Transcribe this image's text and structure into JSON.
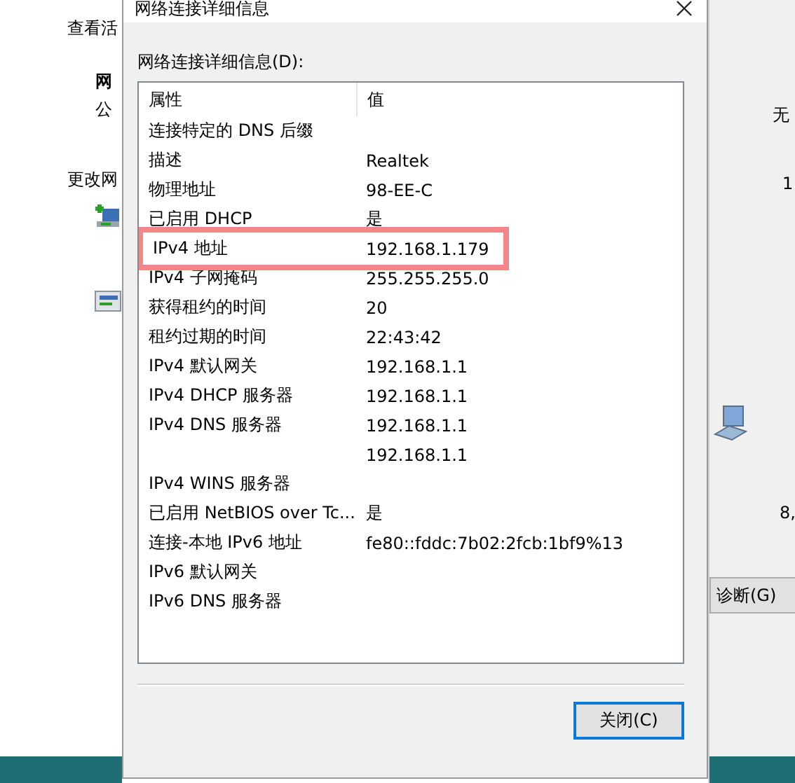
{
  "background_left": {
    "heading": "查看活",
    "network_name": "网",
    "network_type": "公",
    "change_heading": "更改网"
  },
  "background_right": {
    "text_1": "无",
    "text_2": "1",
    "text_3": "8,",
    "diagnose_button": "诊断(G)"
  },
  "dialog": {
    "title": "网络连接详细信息",
    "list_label": "网络连接详细信息(D):",
    "columns": [
      "属性",
      "值"
    ],
    "rows": [
      {
        "property": "连接特定的 DNS 后缀",
        "value": "",
        "highlighted": false
      },
      {
        "property": "描述",
        "value": "Realtek",
        "highlighted": false
      },
      {
        "property": "物理地址",
        "value": "98-EE-C",
        "highlighted": false
      },
      {
        "property": "已启用 DHCP",
        "value": "是",
        "highlighted": false
      },
      {
        "property": "IPv4 地址",
        "value": "192.168.1.179",
        "highlighted": true
      },
      {
        "property": "IPv4 子网掩码",
        "value": "255.255.255.0",
        "highlighted": false
      },
      {
        "property": "获得租约的时间",
        "value": "20",
        "highlighted": false
      },
      {
        "property": "租约过期的时间",
        "value": "22:43:42",
        "highlighted": false
      },
      {
        "property": "IPv4 默认网关",
        "value": "192.168.1.1",
        "highlighted": false
      },
      {
        "property": "IPv4 DHCP 服务器",
        "value": "192.168.1.1",
        "highlighted": false
      },
      {
        "property": "IPv4 DNS 服务器",
        "value": "192.168.1.1",
        "highlighted": false
      },
      {
        "property": "",
        "value": "192.168.1.1",
        "highlighted": false
      },
      {
        "property": "IPv4 WINS 服务器",
        "value": "",
        "highlighted": false
      },
      {
        "property": "已启用 NetBIOS over Tc...",
        "value": "是",
        "highlighted": false
      },
      {
        "property": "连接-本地 IPv6 地址",
        "value": "fe80::fddc:7b02:2fcb:1bf9%13",
        "highlighted": false
      },
      {
        "property": "IPv6 默认网关",
        "value": "",
        "highlighted": false
      },
      {
        "property": "IPv6 DNS 服务器",
        "value": "",
        "highlighted": false
      }
    ],
    "close_button": "关闭(C)"
  }
}
